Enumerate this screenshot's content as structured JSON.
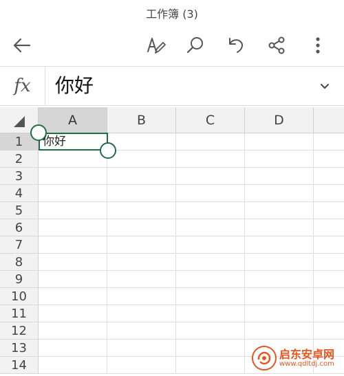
{
  "window": {
    "title": "工作簿 (3)"
  },
  "toolbar": {
    "icons": [
      "back-arrow-icon",
      "draw-pen-icon",
      "search-icon",
      "undo-icon",
      "share-icon",
      "more-vertical-icon"
    ],
    "accent_color": "#1f6e43",
    "icon_color": "#555555"
  },
  "formula_bar": {
    "fx_label": "fx",
    "value": "你好",
    "chevron": "chevron-down-icon"
  },
  "sheet": {
    "columns": [
      "A",
      "B",
      "C",
      "D"
    ],
    "rows": [
      "1",
      "2",
      "3",
      "4",
      "5",
      "6",
      "7",
      "8",
      "9",
      "10",
      "11",
      "12",
      "13",
      "14"
    ],
    "cells": {
      "A1": "你好"
    },
    "selected_cell": "A1",
    "selection_color": "#1f6e43"
  },
  "watermark": {
    "title": "启东安卓网",
    "url": "www.qdltdj.com",
    "color": "#e8541e"
  }
}
